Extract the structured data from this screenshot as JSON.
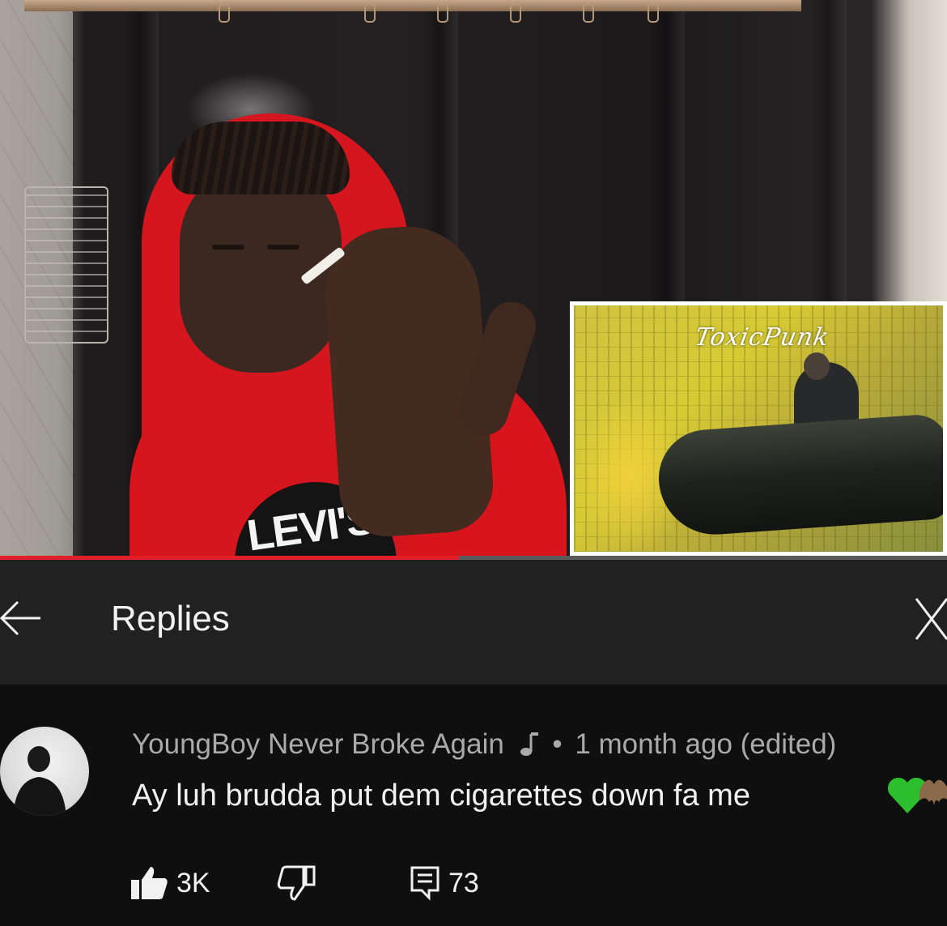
{
  "video": {
    "hoodie_logo": "LEVI'S",
    "progress": 0.485
  },
  "thumbnail": {
    "title": "ToxicPunk"
  },
  "replies_header": {
    "title": "Replies"
  },
  "comment": {
    "author": "YoungBoy Never Broke Again",
    "time": "1 month ago (edited)",
    "separator": "•",
    "text": "Ay luh brudda put dem cigarettes down fa me",
    "like_count": "3K",
    "reply_count": "73"
  },
  "colors": {
    "background": "#0f0f0f",
    "header_bg": "#212121",
    "progress_red": "#e21f26",
    "secondary_text": "#aaaaaa",
    "heart_green": "#2dbe2d"
  },
  "icons": [
    "back-arrow-icon",
    "close-icon",
    "music-note-icon",
    "green-heart-icon",
    "bat-icon",
    "thumbs-up-icon",
    "thumbs-down-icon",
    "reply-comment-icon"
  ]
}
